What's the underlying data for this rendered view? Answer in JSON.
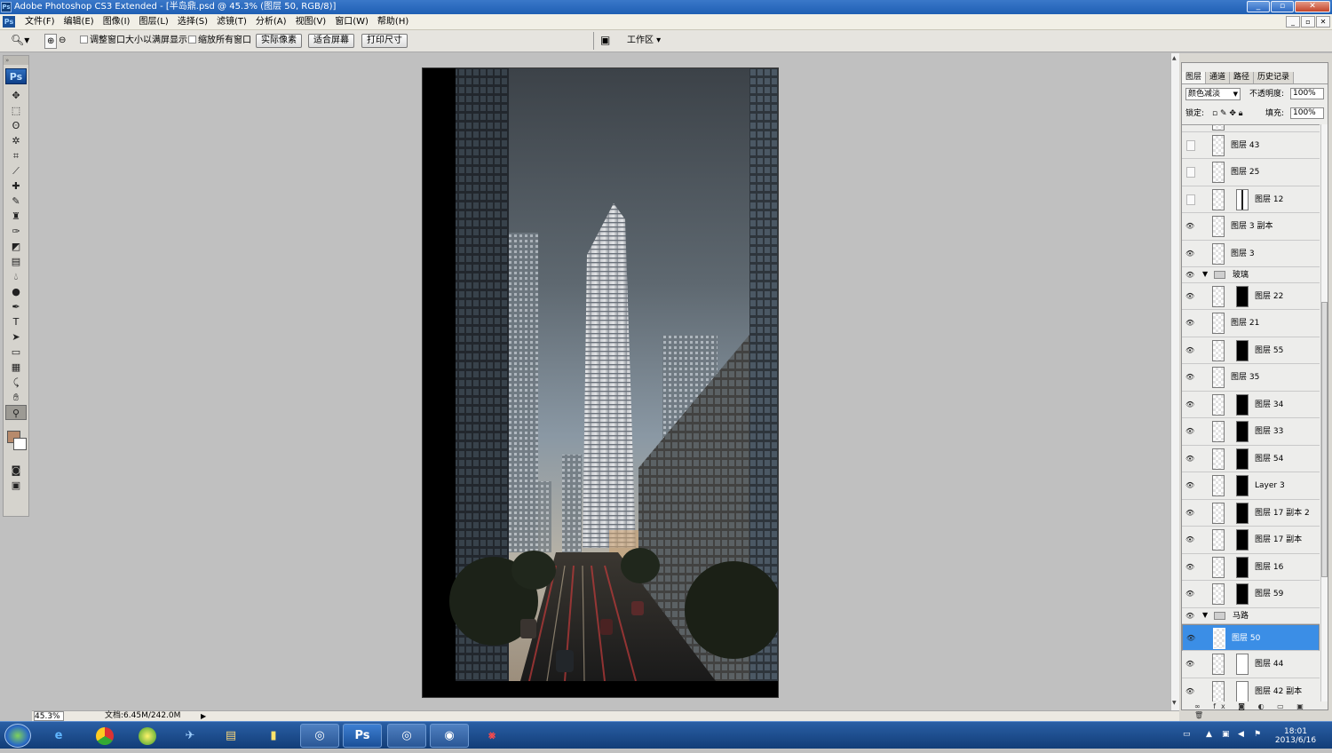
{
  "titlebar": {
    "title": "Adobe Photoshop CS3 Extended - [半岛鼎.psd @ 45.3% (图层 50, RGB/8)]",
    "icon": "Ps"
  },
  "window_controls": {
    "minimize": "_",
    "restore": "▫",
    "close": "✕"
  },
  "menu": {
    "items": [
      "文件(F)",
      "编辑(E)",
      "图像(I)",
      "图层(L)",
      "选择(S)",
      "滤镜(T)",
      "分析(A)",
      "视图(V)",
      "窗口(W)",
      "帮助(H)"
    ]
  },
  "options": {
    "resize_windows_label": "调整窗口大小以满屏显示",
    "zoom_all_label": "缩放所有窗口",
    "actual_pixels": "实际像素",
    "fit_screen": "适合屏幕",
    "print_size": "打印尺寸",
    "workspace": "工作区"
  },
  "toolbox": {
    "logo": "Ps"
  },
  "status": {
    "zoom": "45.3%",
    "doc": "文档:6.45M/242.0M"
  },
  "panel": {
    "tabs": [
      "图层",
      "通道",
      "路径",
      "历史记录"
    ],
    "blend_mode": "颜色减淡",
    "opacity_label": "不透明度:",
    "opacity": "100%",
    "lock_label": "锁定:",
    "fill_label": "填充:",
    "fill": "100%",
    "layers": [
      {
        "name": "图层 43",
        "visible": false,
        "mask": false
      },
      {
        "name": "图层 25",
        "visible": false,
        "mask": false
      },
      {
        "name": "图层 12",
        "visible": false,
        "mask": true
      },
      {
        "name": "图层 3 副本",
        "visible": true,
        "mask": false
      },
      {
        "name": "图层 3",
        "visible": true,
        "mask": false
      },
      {
        "name": "玻璃",
        "visible": true,
        "group": true
      },
      {
        "name": "图层 22",
        "visible": true,
        "mask": true
      },
      {
        "name": "图层 21",
        "visible": true,
        "mask": false
      },
      {
        "name": "图层 55",
        "visible": true,
        "mask": true
      },
      {
        "name": "图层 35",
        "visible": true,
        "mask": false
      },
      {
        "name": "图层 34",
        "visible": true,
        "mask": true
      },
      {
        "name": "图层 33",
        "visible": true,
        "mask": true
      },
      {
        "name": "图层 54",
        "visible": true,
        "mask": true
      },
      {
        "name": "Layer 3",
        "visible": true,
        "mask": true
      },
      {
        "name": "图层 17 副本 2",
        "visible": true,
        "mask": true
      },
      {
        "name": "图层 17 副本",
        "visible": true,
        "mask": true
      },
      {
        "name": "图层 16",
        "visible": true,
        "mask": true
      },
      {
        "name": "图层 59",
        "visible": true,
        "mask": true
      },
      {
        "name": "马路",
        "visible": true,
        "group": true
      },
      {
        "name": "图层 50",
        "visible": true,
        "mask": false,
        "selected": true
      },
      {
        "name": "图层 44",
        "visible": true,
        "mask": true
      },
      {
        "name": "图层 42 副本",
        "visible": true,
        "mask": true
      }
    ]
  },
  "taskbar": {
    "ps_label": "Ps",
    "time": "18:01",
    "date": "2013/6/16"
  }
}
